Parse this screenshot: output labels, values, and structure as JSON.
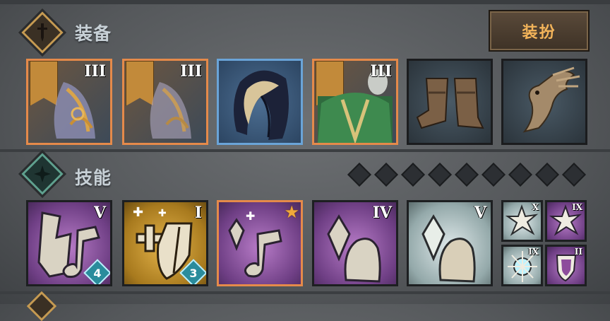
{
  "equipment": {
    "title": "装备",
    "dress_button": "装扮",
    "slots": [
      {
        "name": "weapon-scroll-1",
        "tier": "III",
        "rarity": "orange",
        "banner": true
      },
      {
        "name": "weapon-scroll-2",
        "tier": "III",
        "rarity": "orange",
        "banner": true
      },
      {
        "name": "hood",
        "tier": "",
        "rarity": "blue",
        "banner": false
      },
      {
        "name": "armor",
        "tier": "III",
        "rarity": "orange",
        "banner": true
      },
      {
        "name": "boots",
        "tier": "",
        "rarity": "gray",
        "banner": false
      },
      {
        "name": "eagle-trinket",
        "tier": "",
        "rarity": "gray",
        "banner": false
      }
    ]
  },
  "skills": {
    "title": "技能",
    "slot_indicators": 9,
    "items": [
      {
        "name": "music-skill",
        "tier": "V",
        "badge": "4",
        "color": "purple"
      },
      {
        "name": "heal-shield-skill",
        "tier": "I",
        "badge": "3",
        "color": "gold"
      },
      {
        "name": "crystal-music-skill",
        "tier": "",
        "badge": "",
        "color": "purple",
        "starred": true
      },
      {
        "name": "crystal-hand-skill",
        "tier": "IV",
        "badge": "",
        "color": "purple"
      },
      {
        "name": "crystal-hand-skill-2",
        "tier": "V",
        "badge": "",
        "color": "teal"
      }
    ],
    "small": [
      {
        "name": "burst-skill",
        "tier": "X",
        "color": "teal"
      },
      {
        "name": "burst-skill-2",
        "tier": "IX",
        "color": "purple"
      },
      {
        "name": "frost-burst-skill",
        "tier": "IX",
        "color": "teal"
      },
      {
        "name": "shield-skill",
        "tier": "II",
        "color": "purple"
      }
    ]
  },
  "colors": {
    "accent": "#e58a4a",
    "button_text": "#f3b45a",
    "title_text": "#c7d0d6"
  }
}
